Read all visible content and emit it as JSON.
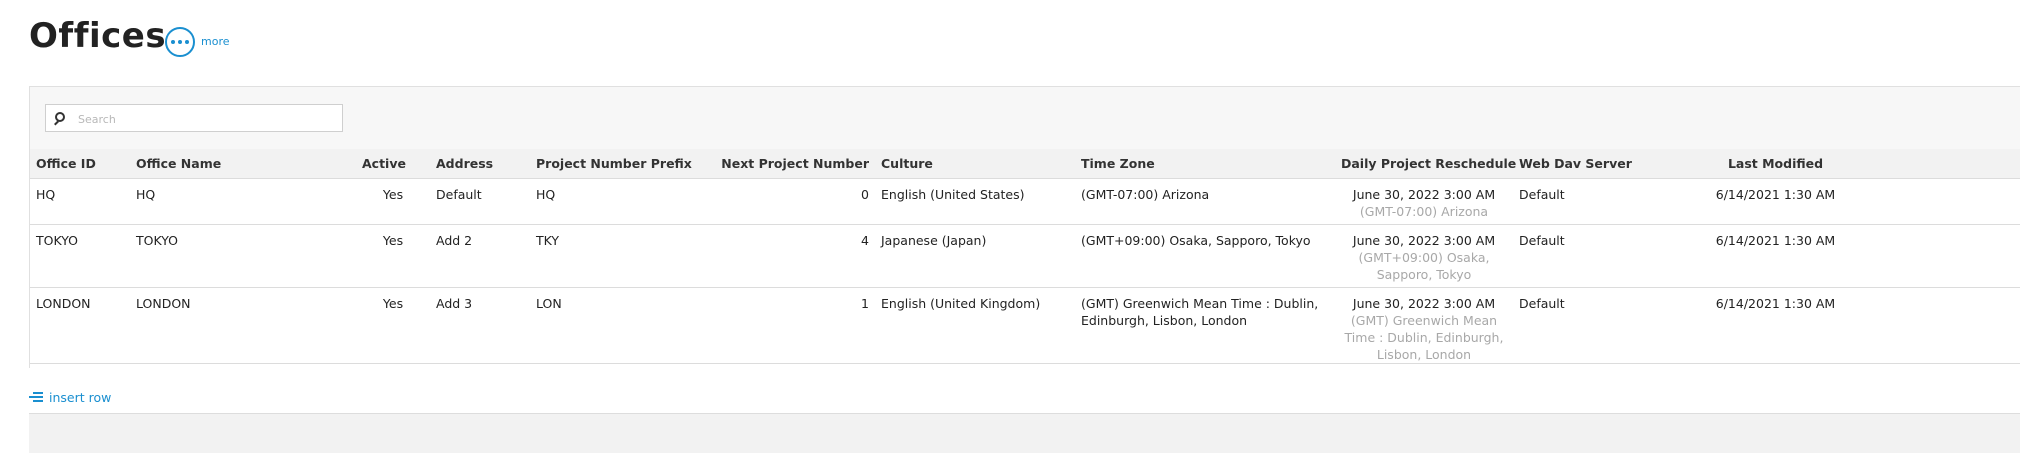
{
  "page": {
    "title": "Offices",
    "more_label": "more"
  },
  "search": {
    "placeholder": "Search"
  },
  "columns": {
    "office_id": "Office ID",
    "office_name": "Office Name",
    "active": "Active",
    "address": "Address",
    "prefix": "Project Number Prefix",
    "next_number": "Next Project Number",
    "culture": "Culture",
    "time_zone": "Time Zone",
    "daily_reschedule": "Daily Project Reschedule",
    "webdav": "Web Dav Server",
    "last_modified": "Last Modified"
  },
  "rows": [
    {
      "office_id": "HQ",
      "office_name": "HQ",
      "active": "Yes",
      "address": "Default",
      "prefix": "HQ",
      "next_number": "0",
      "culture": "English (United States)",
      "time_zone": "(GMT-07:00) Arizona",
      "reschedule_time": "June 30, 2022 3:00 AM",
      "reschedule_tz": "(GMT-07:00) Arizona",
      "webdav": "Default",
      "last_modified": "6/14/2021 1:30 AM"
    },
    {
      "office_id": "TOKYO",
      "office_name": "TOKYO",
      "active": "Yes",
      "address": "Add 2",
      "prefix": "TKY",
      "next_number": "4",
      "culture": "Japanese (Japan)",
      "time_zone": "(GMT+09:00) Osaka, Sapporo, Tokyo",
      "reschedule_time": "June 30, 2022 3:00 AM",
      "reschedule_tz": "(GMT+09:00) Osaka, Sapporo, Tokyo",
      "webdav": "Default",
      "last_modified": "6/14/2021 1:30 AM"
    },
    {
      "office_id": "LONDON",
      "office_name": "LONDON",
      "active": "Yes",
      "address": "Add 3",
      "prefix": "LON",
      "next_number": "1",
      "culture": "English (United Kingdom)",
      "time_zone": "(GMT) Greenwich Mean Time : Dublin, Edinburgh, Lisbon, London",
      "reschedule_time": "June 30, 2022 3:00 AM",
      "reschedule_tz": "(GMT) Greenwich Mean Time : Dublin, Edinburgh, Lisbon, London",
      "webdav": "Default",
      "last_modified": "6/14/2021 1:30 AM"
    }
  ],
  "actions": {
    "insert_row": "insert row"
  },
  "colors": {
    "accent": "#1a8fd0",
    "header_bg": "#f2f2f2",
    "muted_text": "#a8a8a8"
  },
  "icons": {
    "more": "more-dots-icon",
    "search": "search-icon",
    "insert": "insert-row-icon"
  }
}
